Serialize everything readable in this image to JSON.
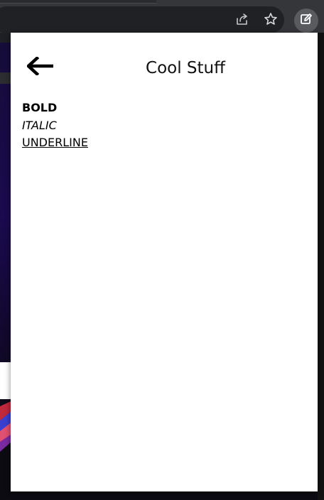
{
  "browser": {
    "toolbar_icons": [
      "share-icon",
      "star-icon",
      "extension-edit-icon"
    ],
    "colors": {
      "toolbar": "#35363a",
      "omnibox": "#202124",
      "active_extension": "#5a5b5f"
    }
  },
  "popup": {
    "title": "Cool Stuff",
    "back_icon": "arrow-left-icon",
    "formatting": {
      "bold": "BOLD",
      "italic": "ITALIC",
      "underline": "UNDERLINE"
    }
  }
}
